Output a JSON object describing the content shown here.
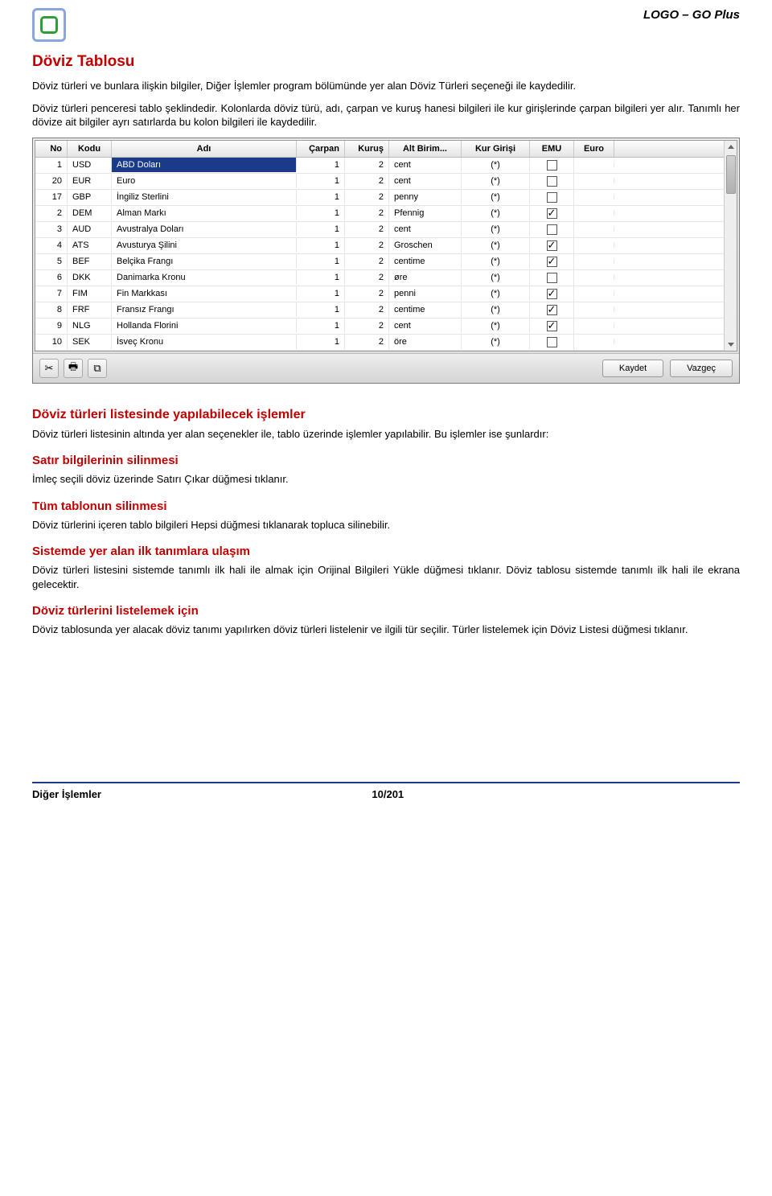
{
  "header": {
    "brand": "LOGO – GO Plus"
  },
  "title": "Döviz Tablosu",
  "intro1": "Döviz türleri ve bunlara ilişkin bilgiler, Diğer İşlemler program bölümünde yer alan Döviz Türleri seçeneği ile kaydedilir.",
  "intro2": "Döviz türleri penceresi tablo şeklindedir. Kolonlarda döviz türü, adı, çarpan ve kuruş hanesi bilgileri ile kur girişlerinde çarpan bilgileri yer alır. Tanımlı her dövize ait bilgiler ayrı satırlarda bu kolon bilgileri ile kaydedilir.",
  "table": {
    "columns": {
      "no": "No",
      "kodu": "Kodu",
      "adi": "Adı",
      "carpan": "Çarpan",
      "kurus": "Kuruş",
      "altbirim": "Alt Birim...",
      "kurgirisi": "Kur Girişi",
      "emu": "EMU",
      "euro": "Euro"
    },
    "rows": [
      {
        "no": "1",
        "kodu": "USD",
        "adi": "ABD Doları",
        "carpan": "1",
        "kurus": "2",
        "alt": "cent",
        "kur": "(*)",
        "emu": false,
        "selected": true
      },
      {
        "no": "20",
        "kodu": "EUR",
        "adi": "Euro",
        "carpan": "1",
        "kurus": "2",
        "alt": "cent",
        "kur": "(*)",
        "emu": false
      },
      {
        "no": "17",
        "kodu": "GBP",
        "adi": "İngiliz Sterlini",
        "carpan": "1",
        "kurus": "2",
        "alt": "penny",
        "kur": "(*)",
        "emu": false
      },
      {
        "no": "2",
        "kodu": "DEM",
        "adi": "Alman Markı",
        "carpan": "1",
        "kurus": "2",
        "alt": "Pfennig",
        "kur": "(*)",
        "emu": true
      },
      {
        "no": "3",
        "kodu": "AUD",
        "adi": "Avustralya Doları",
        "carpan": "1",
        "kurus": "2",
        "alt": "cent",
        "kur": "(*)",
        "emu": false
      },
      {
        "no": "4",
        "kodu": "ATS",
        "adi": "Avusturya Şilini",
        "carpan": "1",
        "kurus": "2",
        "alt": "Groschen",
        "kur": "(*)",
        "emu": true
      },
      {
        "no": "5",
        "kodu": "BEF",
        "adi": "Belçika Frangı",
        "carpan": "1",
        "kurus": "2",
        "alt": "centime",
        "kur": "(*)",
        "emu": true
      },
      {
        "no": "6",
        "kodu": "DKK",
        "adi": "Danimarka Kronu",
        "carpan": "1",
        "kurus": "2",
        "alt": "øre",
        "kur": "(*)",
        "emu": false
      },
      {
        "no": "7",
        "kodu": "FIM",
        "adi": "Fin Markkası",
        "carpan": "1",
        "kurus": "2",
        "alt": "penni",
        "kur": "(*)",
        "emu": true
      },
      {
        "no": "8",
        "kodu": "FRF",
        "adi": "Fransız Frangı",
        "carpan": "1",
        "kurus": "2",
        "alt": "centime",
        "kur": "(*)",
        "emu": true
      },
      {
        "no": "9",
        "kodu": "NLG",
        "adi": "Hollanda Florini",
        "carpan": "1",
        "kurus": "2",
        "alt": "cent",
        "kur": "(*)",
        "emu": true
      },
      {
        "no": "10",
        "kodu": "SEK",
        "adi": "İsveç Kronu",
        "carpan": "1",
        "kurus": "2",
        "alt": "öre",
        "kur": "(*)",
        "emu": false
      }
    ],
    "buttons": {
      "save": "Kaydet",
      "cancel": "Vazgeç"
    }
  },
  "sections": {
    "s1_title": "Döviz türleri listesinde yapılabilecek işlemler",
    "s1_body": "Döviz türleri listesinin altında yer alan seçenekler ile, tablo üzerinde işlemler yapılabilir. Bu işlemler ise şunlardır:",
    "s2_title": "Satır bilgilerinin silinmesi",
    "s2_body": "İmleç seçili döviz üzerinde Satırı Çıkar düğmesi tıklanır.",
    "s3_title": "Tüm tablonun silinmesi",
    "s3_body": "Döviz türlerini içeren tablo bilgileri Hepsi düğmesi tıklanarak topluca silinebilir.",
    "s4_title": "Sistemde yer alan ilk tanımlara ulaşım",
    "s4_body": "Döviz türleri listesini sistemde tanımlı ilk hali ile almak için Orijinal Bilgileri Yükle düğmesi tıklanır. Döviz tablosu sistemde tanımlı ilk hali ile ekrana gelecektir.",
    "s5_title": "Döviz türlerini listelemek için",
    "s5_body": "Döviz tablosunda yer alacak döviz tanımı yapılırken döviz türleri listelenir ve ilgili tür seçilir. Türler listelemek için Döviz Listesi düğmesi tıklanır."
  },
  "footer": {
    "left": "Diğer İşlemler",
    "page": "10/201"
  }
}
